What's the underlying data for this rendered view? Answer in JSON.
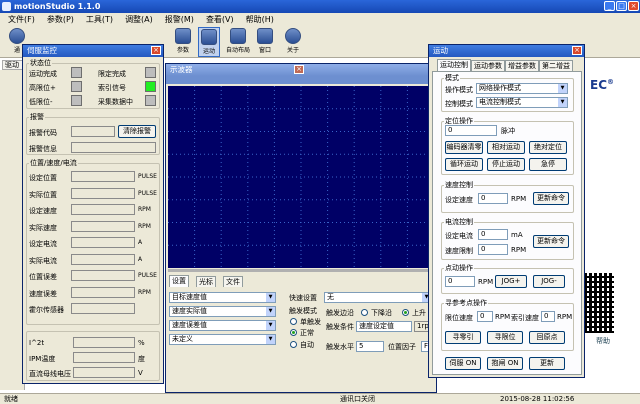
{
  "app": {
    "title": "motionStudio 1.1.0"
  },
  "menu": [
    "文件(F)",
    "参数(P)",
    "工具(T)",
    "调整(A)",
    "报警(M)",
    "查看(V)",
    "帮助(H)"
  ],
  "toolbar": {
    "labels": [
      "通",
      "参数",
      "运动",
      "自动布局",
      "窗口",
      "关于"
    ]
  },
  "workspace": {
    "left_tab": "驱动"
  },
  "monitor": {
    "title": "伺服监控",
    "status": {
      "label": "状态位",
      "items": [
        "运动完成",
        "限定完成",
        "高限位+",
        "索引信号",
        "低限位-",
        "采集数据中"
      ]
    },
    "alarm": {
      "label": "报警",
      "code_label": "报警代码",
      "clear_button": "清除报警",
      "info_label": "报警信息"
    },
    "pos_section": {
      "label": "位置/速度/电流",
      "rows": [
        {
          "name": "设定位置",
          "unit": "PULSE"
        },
        {
          "name": "实际位置",
          "unit": "PULSE"
        },
        {
          "name": "设定速度",
          "unit": "RPM"
        },
        {
          "name": "实际速度",
          "unit": "RPM"
        },
        {
          "name": "设定电流",
          "unit": "A"
        },
        {
          "name": "实际电流",
          "unit": "A"
        },
        {
          "name": "位置误差",
          "unit": "PULSE"
        },
        {
          "name": "速度误差",
          "unit": "RPM"
        },
        {
          "name": "霍尔传感器",
          "unit": ""
        }
      ]
    },
    "bottom_rows": [
      {
        "name": "I^2t",
        "unit": "%"
      },
      {
        "name": "IPM温度",
        "unit": "度"
      },
      {
        "name": "直流母线电压",
        "unit": "V"
      }
    ]
  },
  "scope": {
    "title": "示波器",
    "tabs": [
      "设置",
      "光标",
      "文件"
    ],
    "channels": [
      "目标速度值",
      "速度实际值",
      "速度误差值",
      "未定义"
    ],
    "trigger_settings_label": "快速设置",
    "trigger_settings_value": "无",
    "trigger_mode_label": "触发模式",
    "trigger_modes": [
      "单触发",
      "正常",
      "自动"
    ],
    "edge_label": "触发边沿",
    "edge_options": [
      "下降沿",
      "上升"
    ],
    "condition_label": "触发条件",
    "condition_value": "速度设定值",
    "condition_unit": "1rpa",
    "level_label": "触发水平",
    "level_value": "5",
    "position_label": "位置因子",
    "position_value": "Fu"
  },
  "motion": {
    "title": "运动",
    "tabs": [
      "运动控制",
      "运动参数",
      "增益参数",
      "第二增益"
    ],
    "mode": {
      "label": "模式",
      "op_label": "操作模式",
      "op_value": "网络操作模式",
      "ctrl_label": "控制模式",
      "ctrl_value": "电流控制模式"
    },
    "position": {
      "label": "定位操作",
      "value": "0",
      "unit": "脉冲",
      "buttons": [
        "编码器清零",
        "相对运动",
        "绝对定位",
        "循环运动",
        "停止运动",
        "急停"
      ]
    },
    "speed": {
      "label": "速度控制",
      "set_label": "设定速度",
      "value": "0",
      "unit": "RPM",
      "update_button": "更新命令"
    },
    "current": {
      "label": "电流控制",
      "set_label": "设定电流",
      "set_value": "0",
      "set_unit": "mA",
      "limit_label": "速度限制",
      "limit_value": "0",
      "limit_unit": "RPM",
      "update_button": "更新命令"
    },
    "jog": {
      "label": "点动操作",
      "value": "0",
      "unit": "RPM",
      "plus": "JOG+",
      "minus": "JOG-"
    },
    "homing": {
      "label": "寻参考点操作",
      "limit_label": "限位速度",
      "limit_value": "0",
      "limit_unit": "RPM",
      "index_label": "索引速度",
      "index_value": "0",
      "index_unit": "RPM",
      "buttons": [
        "寻零引",
        "寻限位",
        "回原点"
      ]
    },
    "bottom_buttons": [
      "伺服 ON",
      "抱闸 ON",
      "更新"
    ]
  },
  "background": {
    "brand_fragment": "EC",
    "tail": "帮助"
  },
  "status_bar": {
    "left": "就绪",
    "middle": "通讯口关闭",
    "datetime": "2015-08-28 11:02:56"
  },
  "colors": {
    "scope_bg": "#000066",
    "grid": "#3a64c8",
    "accent": "#0a246a",
    "indicator_on": "#22ee22"
  }
}
